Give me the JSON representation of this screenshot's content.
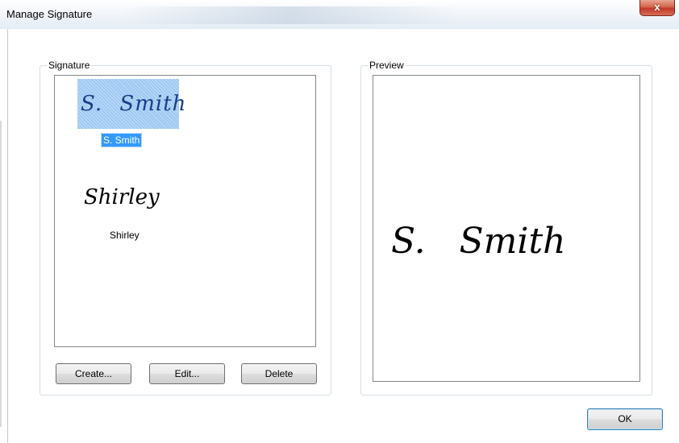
{
  "window": {
    "title": "Manage Signature",
    "close_glyph": "x"
  },
  "signature_group": {
    "label": "Signature",
    "items": [
      {
        "script": "S. Smith",
        "label": "S. Smith",
        "selected": true
      },
      {
        "script": "Shirley",
        "label": "Shirley",
        "selected": false
      }
    ],
    "buttons": {
      "create": "Create...",
      "edit": "Edit...",
      "delete": "Delete"
    }
  },
  "preview_group": {
    "label": "Preview",
    "signature_text": "S.   Smith"
  },
  "footer": {
    "ok": "OK"
  },
  "colors": {
    "selection": "#3399ff",
    "selected_thumb": "#9ec9f3",
    "close_button": "#c0392b"
  }
}
